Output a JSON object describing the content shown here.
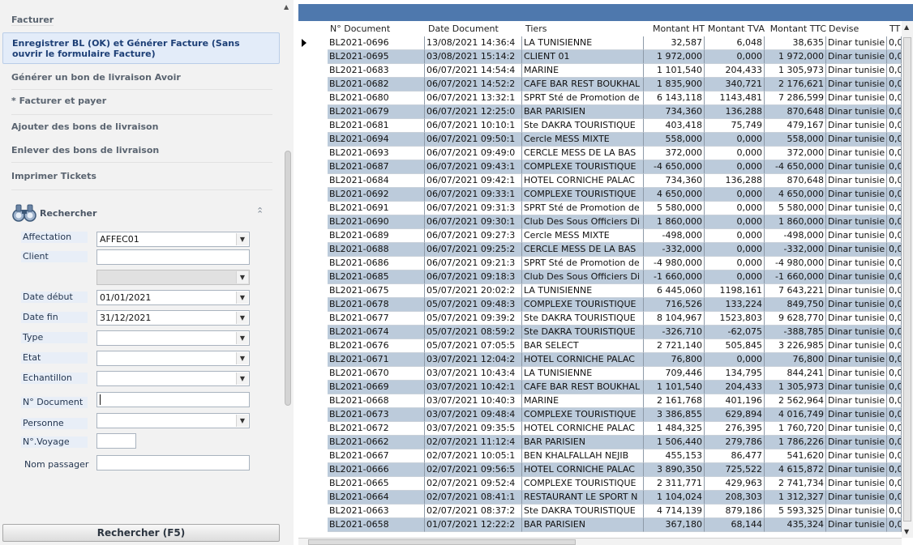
{
  "tasks": [
    {
      "id": "facturer",
      "label": "Facturer"
    },
    {
      "id": "enregistrer",
      "label": "Enregistrer BL (OK) et Générer Facture (Sans ouvrir le formulaire Facture)",
      "highlighted": true
    },
    {
      "id": "avoir",
      "label": "Générer un bon de livraison Avoir"
    },
    {
      "id": "payer",
      "label": "* Facturer et payer"
    },
    {
      "id": "ajouter",
      "label": "Ajouter des bons de livraison"
    },
    {
      "id": "enlever",
      "label": "Enlever des bons de livraison"
    },
    {
      "id": "imprimer",
      "label": "Imprimer Tickets"
    }
  ],
  "search": {
    "title": "Rechercher",
    "fields": [
      {
        "label": "Affectation",
        "value": "AFFEC01",
        "type": "combo"
      },
      {
        "label": "Client",
        "value": "",
        "type": "text"
      },
      {
        "label": "",
        "value": "",
        "type": "combo-disabled"
      },
      {
        "label": "Date début",
        "value": "01/01/2021",
        "type": "combo"
      },
      {
        "label": "Date fin",
        "value": "31/12/2021",
        "type": "combo"
      },
      {
        "label": "Type",
        "value": "",
        "type": "combo"
      },
      {
        "label": "Etat",
        "value": "",
        "type": "combo"
      },
      {
        "label": "Echantillon",
        "value": "",
        "type": "combo"
      },
      {
        "label": "N° Document",
        "value": "",
        "type": "text-focused"
      },
      {
        "label": "Personne",
        "value": "",
        "type": "combo"
      },
      {
        "label": "N°.Voyage",
        "value": "",
        "type": "text-small"
      },
      {
        "label": "Nom passager",
        "value": "",
        "type": "text"
      }
    ],
    "button_label": "Rechercher (F5)"
  },
  "grid": {
    "columns": [
      "N° Document",
      "Date Document",
      "Tiers",
      "Montant HT",
      "Montant TVA",
      "Montant TTC",
      "Devise",
      "TT"
    ],
    "rows": [
      [
        "BL2021-0696",
        "13/08/2021 14:36:4",
        "LA TUNISIENNE",
        "32,587",
        "6,048",
        "38,635",
        "Dinar tunisie",
        "0,0"
      ],
      [
        "BL2021-0695",
        "03/08/2021 15:14:2",
        "CLIENT 01",
        "1 972,000",
        "0,000",
        "1 972,000",
        "Dinar tunisie",
        "0,0"
      ],
      [
        "BL2021-0683",
        "06/07/2021 14:54:4",
        "MARINE",
        "1 101,540",
        "204,433",
        "1 305,973",
        "Dinar tunisie",
        "0,0"
      ],
      [
        "BL2021-0682",
        "06/07/2021 14:52:2",
        "CAFE BAR REST BOUKHAL",
        "1 835,900",
        "340,721",
        "2 176,621",
        "Dinar tunisie",
        "0,0"
      ],
      [
        "BL2021-0680",
        "06/07/2021 13:32:1",
        "SPRT Sté de Promotion de",
        "6 143,118",
        "1143,481",
        "7 286,599",
        "Dinar tunisie",
        "0,0"
      ],
      [
        "BL2021-0679",
        "06/07/2021 12:25:0",
        "BAR PARISIEN",
        "734,360",
        "136,288",
        "870,648",
        "Dinar tunisie",
        "0,0"
      ],
      [
        "BL2021-0681",
        "06/07/2021 10:10:1",
        "Ste DAKRA TOURISTIQUE",
        "403,418",
        "75,749",
        "479,167",
        "Dinar tunisie",
        "0,0"
      ],
      [
        "BL2021-0694",
        "06/07/2021 09:50:1",
        "Cercle MESS MIXTE",
        "558,000",
        "0,000",
        "558,000",
        "Dinar tunisie",
        "0,0"
      ],
      [
        "BL2021-0693",
        "06/07/2021 09:49:0",
        "CERCLE MESS DE LA BAS",
        "372,000",
        "0,000",
        "372,000",
        "Dinar tunisie",
        "0,0"
      ],
      [
        "BL2021-0687",
        "06/07/2021 09:43:1",
        "COMPLEXE TOURISTIQUE",
        "-4 650,000",
        "0,000",
        "-4 650,000",
        "Dinar tunisie",
        "0,0"
      ],
      [
        "BL2021-0684",
        "06/07/2021 09:42:1",
        "HOTEL CORNICHE PALAC",
        "734,360",
        "136,288",
        "870,648",
        "Dinar tunisie",
        "0,0"
      ],
      [
        "BL2021-0692",
        "06/07/2021 09:33:1",
        "COMPLEXE TOURISTIQUE",
        "4 650,000",
        "0,000",
        "4 650,000",
        "Dinar tunisie",
        "0,0"
      ],
      [
        "BL2021-0691",
        "06/07/2021 09:31:3",
        "SPRT Sté de Promotion de",
        "5 580,000",
        "0,000",
        "5 580,000",
        "Dinar tunisie",
        "0,0"
      ],
      [
        "BL2021-0690",
        "06/07/2021 09:30:1",
        "Club Des Sous Officiers Di",
        "1 860,000",
        "0,000",
        "1 860,000",
        "Dinar tunisie",
        "0,0"
      ],
      [
        "BL2021-0689",
        "06/07/2021 09:27:3",
        "Cercle MESS MIXTE",
        "-498,000",
        "0,000",
        "-498,000",
        "Dinar tunisie",
        "0,0"
      ],
      [
        "BL2021-0688",
        "06/07/2021 09:25:2",
        "CERCLE MESS DE LA BAS",
        "-332,000",
        "0,000",
        "-332,000",
        "Dinar tunisie",
        "0,0"
      ],
      [
        "BL2021-0686",
        "06/07/2021 09:21:3",
        "SPRT Sté de Promotion de",
        "-4 980,000",
        "0,000",
        "-4 980,000",
        "Dinar tunisie",
        "0,0"
      ],
      [
        "BL2021-0685",
        "06/07/2021 09:18:3",
        "Club Des Sous Officiers Di",
        "-1 660,000",
        "0,000",
        "-1 660,000",
        "Dinar tunisie",
        "0,0"
      ],
      [
        "BL2021-0675",
        "05/07/2021 20:02:2",
        "LA TUNISIENNE",
        "6 445,060",
        "1198,161",
        "7 643,221",
        "Dinar tunisie",
        "0,0"
      ],
      [
        "BL2021-0678",
        "05/07/2021 09:48:3",
        "COMPLEXE TOURISTIQUE",
        "716,526",
        "133,224",
        "849,750",
        "Dinar tunisie",
        "0,0"
      ],
      [
        "BL2021-0677",
        "05/07/2021 09:39:2",
        "Ste DAKRA TOURISTIQUE",
        "8 104,967",
        "1523,803",
        "9 628,770",
        "Dinar tunisie",
        "0,0"
      ],
      [
        "BL2021-0674",
        "05/07/2021 08:59:2",
        "Ste DAKRA TOURISTIQUE",
        "-326,710",
        "-62,075",
        "-388,785",
        "Dinar tunisie",
        "0,0"
      ],
      [
        "BL2021-0676",
        "05/07/2021 07:05:5",
        "BAR SELECT",
        "2 721,140",
        "505,845",
        "3 226,985",
        "Dinar tunisie",
        "0,0"
      ],
      [
        "BL2021-0671",
        "03/07/2021 12:04:2",
        "HOTEL CORNICHE PALAC",
        "76,800",
        "0,000",
        "76,800",
        "Dinar tunisie",
        "0,0"
      ],
      [
        "BL2021-0670",
        "03/07/2021 10:43:4",
        "LA TUNISIENNE",
        "709,446",
        "134,795",
        "844,241",
        "Dinar tunisie",
        "0,0"
      ],
      [
        "BL2021-0669",
        "03/07/2021 10:42:1",
        "CAFE BAR REST BOUKHAL",
        "1 101,540",
        "204,433",
        "1 305,973",
        "Dinar tunisie",
        "0,0"
      ],
      [
        "BL2021-0668",
        "03/07/2021 10:40:3",
        "MARINE",
        "2 161,768",
        "401,196",
        "2 562,964",
        "Dinar tunisie",
        "0,0"
      ],
      [
        "BL2021-0673",
        "03/07/2021 09:48:4",
        "COMPLEXE TOURISTIQUE",
        "3 386,855",
        "629,894",
        "4 016,749",
        "Dinar tunisie",
        "0,0"
      ],
      [
        "BL2021-0672",
        "03/07/2021 09:35:5",
        "HOTEL CORNICHE PALAC",
        "1 484,325",
        "276,395",
        "1 760,720",
        "Dinar tunisie",
        "0,0"
      ],
      [
        "BL2021-0662",
        "02/07/2021 11:12:4",
        "BAR PARISIEN",
        "1 506,440",
        "279,786",
        "1 786,226",
        "Dinar tunisie",
        "0,0"
      ],
      [
        "BL2021-0667",
        "02/07/2021 10:05:1",
        "BEN KHALFALLAH NEJIB",
        "455,153",
        "86,477",
        "541,620",
        "Dinar tunisie",
        "0,0"
      ],
      [
        "BL2021-0666",
        "02/07/2021 09:56:5",
        "HOTEL CORNICHE PALAC",
        "3 890,350",
        "725,522",
        "4 615,872",
        "Dinar tunisie",
        "0,0"
      ],
      [
        "BL2021-0665",
        "02/07/2021 09:52:4",
        "COMPLEXE TOURISTIQUE",
        "2 311,771",
        "429,963",
        "2 741,734",
        "Dinar tunisie",
        "0,0"
      ],
      [
        "BL2021-0664",
        "02/07/2021 08:41:1",
        "RESTAURANT LE SPORT N",
        "1 104,024",
        "208,303",
        "1 312,327",
        "Dinar tunisie",
        "0,0"
      ],
      [
        "BL2021-0663",
        "02/07/2021 08:37:2",
        "Ste DAKRA TOURISTIQUE",
        "4 714,139",
        "879,186",
        "5 593,325",
        "Dinar tunisie",
        "0,0"
      ],
      [
        "BL2021-0658",
        "01/07/2021 12:22:2",
        "BAR PARISIEN",
        "367,180",
        "68,144",
        "435,324",
        "Dinar tunisie",
        "0,0"
      ]
    ]
  }
}
